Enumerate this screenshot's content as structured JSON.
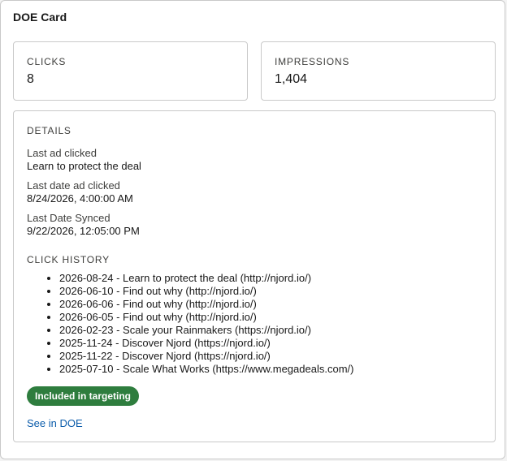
{
  "card": {
    "title": "DOE Card"
  },
  "metrics": {
    "clicks": {
      "label": "CLICKS",
      "value": "8"
    },
    "impressions": {
      "label": "IMPRESSIONS",
      "value": "1,404"
    }
  },
  "details": {
    "heading": "DETAILS",
    "last_ad_clicked": {
      "label": "Last ad clicked",
      "value": "Learn to protect the deal"
    },
    "last_date_ad_clicked": {
      "label": "Last date ad clicked",
      "value": "8/24/2026, 4:00:00 AM"
    },
    "last_date_synced": {
      "label": "Last Date Synced",
      "value": "9/22/2026, 12:05:00 PM"
    }
  },
  "click_history": {
    "heading": "CLICK HISTORY",
    "items": [
      "2026-08-24 - Learn to protect the deal (http://njord.io/)",
      "2026-06-10 - Find out why (http://njord.io/)",
      "2026-06-06 - Find out why (http://njord.io/)",
      "2026-06-05 - Find out why (http://njord.io/)",
      "2026-02-23 - Scale your Rainmakers (https://njord.io/)",
      "2025-11-24 - Discover Njord (https://njord.io/)",
      "2025-11-22 - Discover Njord (https://njord.io/)",
      "2025-07-10 - Scale What Works (https://www.megadeals.com/)"
    ]
  },
  "targeting_badge": {
    "label": "Included in targeting",
    "color": "#2e7d3e"
  },
  "see_in_doe_link": {
    "label": "See in DOE",
    "color": "#0b5cab"
  }
}
